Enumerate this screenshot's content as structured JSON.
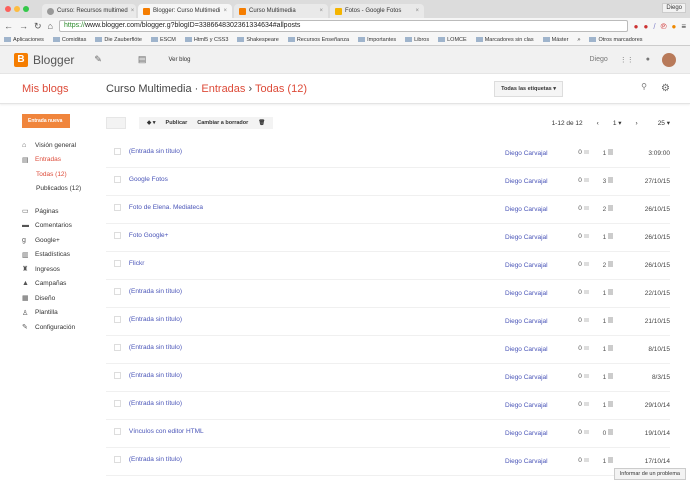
{
  "browser": {
    "tabs": [
      {
        "label": "Curso: Recursos multimed"
      },
      {
        "label": "Blogger: Curso Multimedi"
      },
      {
        "label": "Curso Multimedia"
      },
      {
        "label": "Fotos - Google Fotos"
      }
    ],
    "user": "Diego",
    "url_scheme": "https://",
    "url_rest": "www.blogger.com/blogger.g?blogID=3386648302361334634#allposts",
    "bookmarks": [
      "Aplicaciones",
      "Comiditas",
      "Die Zauberflöte",
      "ESCM",
      "Html5 y CSS3",
      "Shakespeare",
      "Recursos Enseñanza",
      "Importantes",
      "Libros",
      "LOMCE",
      "Marcadores sin clas",
      "Máster",
      "»",
      "Otros marcadores"
    ]
  },
  "header": {
    "brand": "Blogger",
    "ver_blog": "Ver blog",
    "user": "Diego"
  },
  "subheader": {
    "mis_blogs": "Mis blogs",
    "blog": "Curso Multimedia",
    "sep": "·",
    "section": "Entradas",
    "arrow": "›",
    "filter": "Todas (12)",
    "labels_btn": "Todas las etiquetas ▾"
  },
  "sidebar": {
    "new_post": "Entrada nueva",
    "items": [
      {
        "label": "Visión general",
        "icon": "⌂"
      },
      {
        "label": "Entradas",
        "icon": "▤"
      },
      {
        "label": "Todas (12)"
      },
      {
        "label": "Publicados (12)"
      },
      {
        "label": "Páginas",
        "icon": "▭"
      },
      {
        "label": "Comentarios",
        "icon": "▬"
      },
      {
        "label": "Google+",
        "icon": "g"
      },
      {
        "label": "Estadísticas",
        "icon": "▥"
      },
      {
        "label": "Ingresos",
        "icon": "♜"
      },
      {
        "label": "Campañas",
        "icon": "▲"
      },
      {
        "label": "Diseño",
        "icon": "▦"
      },
      {
        "label": "Plantilla",
        "icon": "♙"
      },
      {
        "label": "Configuración",
        "icon": "✎"
      }
    ]
  },
  "toolbar": {
    "publish": "Publicar",
    "draft": "Cambiar a borrador",
    "range": "1-12 de 12",
    "page": "1 ▾",
    "per_page": "25 ▾"
  },
  "posts": [
    {
      "title": "(Entrada sin título)",
      "author": "Diego Carvajal",
      "comments": "0",
      "views": "1",
      "date": "3:09:00"
    },
    {
      "title": "Google Fotos",
      "author": "Diego Carvajal",
      "comments": "0",
      "views": "3",
      "date": "27/10/15"
    },
    {
      "title": "Foto de Elena. Mediateca",
      "author": "Diego Carvajal",
      "comments": "0",
      "views": "2",
      "date": "26/10/15"
    },
    {
      "title": "Foto Google+",
      "author": "Diego Carvajal",
      "comments": "0",
      "views": "1",
      "date": "26/10/15"
    },
    {
      "title": "Flickr",
      "author": "Diego Carvajal",
      "comments": "0",
      "views": "2",
      "date": "26/10/15"
    },
    {
      "title": "(Entrada sin título)",
      "author": "Diego Carvajal",
      "comments": "0",
      "views": "1",
      "date": "22/10/15"
    },
    {
      "title": "(Entrada sin título)",
      "author": "Diego Carvajal",
      "comments": "0",
      "views": "1",
      "date": "21/10/15"
    },
    {
      "title": "(Entrada sin título)",
      "author": "Diego Carvajal",
      "comments": "0",
      "views": "1",
      "date": "8/10/15"
    },
    {
      "title": "(Entrada sin título)",
      "author": "Diego Carvajal",
      "comments": "0",
      "views": "1",
      "date": "8/3/15"
    },
    {
      "title": "(Entrada sin título)",
      "author": "Diego Carvajal",
      "comments": "0",
      "views": "1",
      "date": "29/10/14"
    },
    {
      "title": "Vínculos con editor HTML",
      "author": "Diego Carvajal",
      "comments": "0",
      "views": "0",
      "date": "19/10/14"
    },
    {
      "title": "(Entrada sin título)",
      "author": "Diego Carvajal",
      "comments": "0",
      "views": "1",
      "date": "17/10/14"
    }
  ],
  "report": "Informar de un problema"
}
